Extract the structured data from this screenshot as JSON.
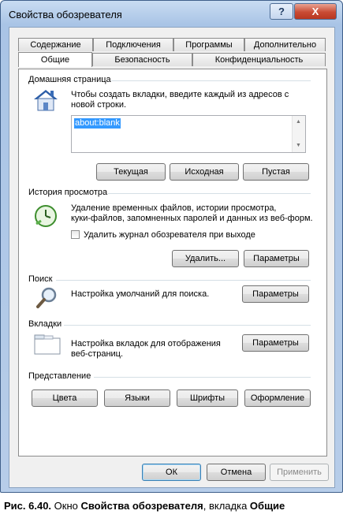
{
  "window": {
    "title": "Свойства обозревателя",
    "help_glyph": "?",
    "close_glyph": "X"
  },
  "tabs_top": [
    "Содержание",
    "Подключения",
    "Программы",
    "Дополнительно"
  ],
  "tabs_bottom": [
    "Общие",
    "Безопасность",
    "Конфиденциальность"
  ],
  "active_tab": "Общие",
  "home": {
    "group": "Домашняя страница",
    "text1": "Чтобы создать вкладки, введите каждый из адресов с",
    "text2": "новой строки.",
    "url": "about:blank",
    "btn_current": "Текущая",
    "btn_default": "Исходная",
    "btn_blank": "Пустая"
  },
  "history": {
    "group": "История просмотра",
    "text1": "Удаление временных файлов, истории просмотра,",
    "text2": "куки-файлов, запомненных паролей и данных из веб-форм.",
    "checkbox": "Удалить журнал обозревателя при выходе",
    "checked": false,
    "btn_delete": "Удалить...",
    "btn_settings": "Параметры"
  },
  "search": {
    "group": "Поиск",
    "text": "Настройка умолчаний для поиска.",
    "btn_settings": "Параметры"
  },
  "tabs_section": {
    "group": "Вкладки",
    "text1": "Настройка вкладок для отображения",
    "text2": "веб-страниц.",
    "btn_settings": "Параметры"
  },
  "appearance": {
    "group": "Представление",
    "btn_colors": "Цвета",
    "btn_languages": "Языки",
    "btn_fonts": "Шрифты",
    "btn_accessibility": "Оформление"
  },
  "footer": {
    "ok": "ОК",
    "cancel": "Отмена",
    "apply": "Применить"
  },
  "caption": {
    "prefix": "Рис. 6.40.",
    "text1": " Окно ",
    "bold1": "Свойства обозревателя",
    "text2": ", вкладка ",
    "bold2": "Общие"
  },
  "colors": {
    "selection": "#3399ff",
    "close_button": "#c94b34",
    "title_bar": "#b7cde9"
  }
}
